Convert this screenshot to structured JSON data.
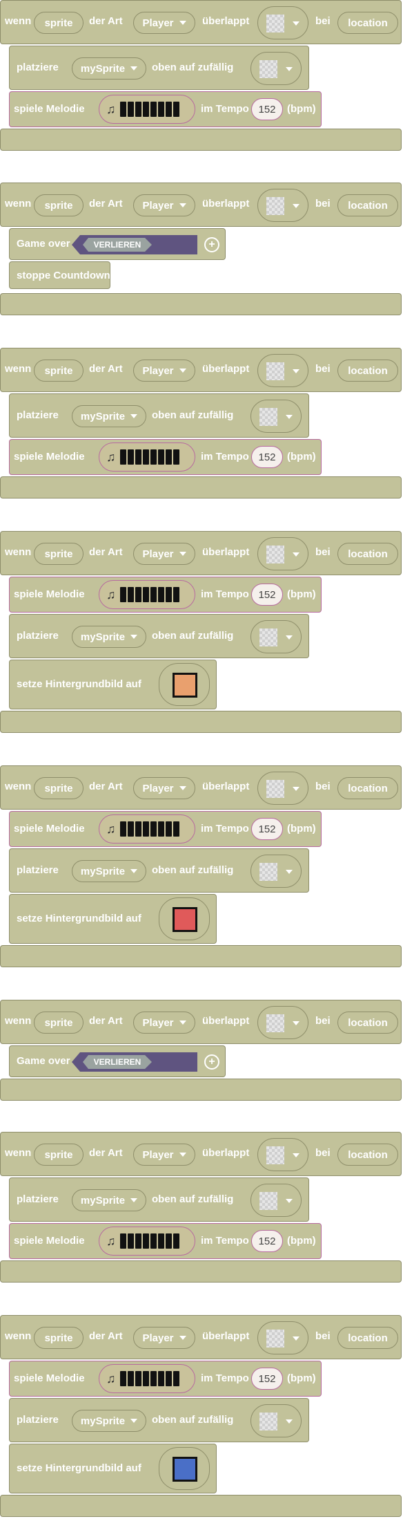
{
  "labels": {
    "wenn": "wenn",
    "sprite": "sprite",
    "der_art": "der Art",
    "player": "Player",
    "ueberlappt": "überlappt",
    "bei": "bei",
    "location": "location",
    "platziere": "platziere",
    "mysprite": "mySprite",
    "oben_auf": "oben auf zufällig",
    "spiele_melodie": "spiele Melodie",
    "im_tempo": "im Tempo",
    "tempo_value": "152",
    "bpm": "(bpm)",
    "game_over": "Game over",
    "verlieren": "VERLIEREN",
    "plus": "+",
    "stoppe": "stoppe Countdown",
    "setze_hintergrund": "setze Hintergrundbild auf"
  },
  "colors": {
    "block": "#c2c29a",
    "music_outline": "#b76a9f",
    "gameover_tag": "#5f5480",
    "swatch_orange": "#e9a06e",
    "swatch_red": "#e05a5a",
    "swatch_blue": "#4a6fc7"
  }
}
